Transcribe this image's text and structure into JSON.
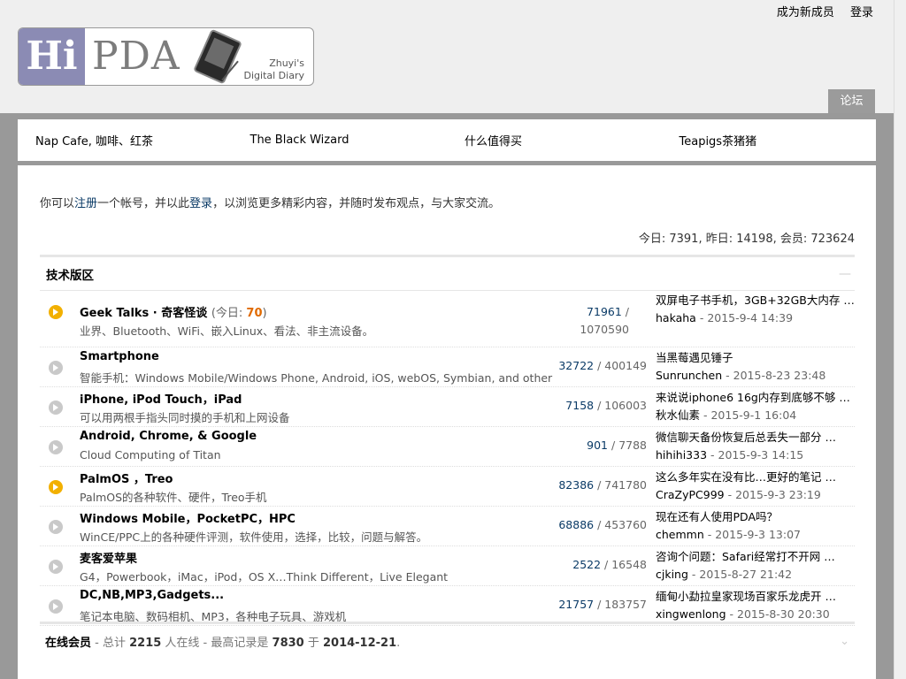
{
  "top_links": [
    "成为新成员",
    "登录"
  ],
  "logo": {
    "hi": "Hi",
    "pda": "PDA",
    "tagline1": "Zhuyi's",
    "tagline2": "Digital Diary"
  },
  "forum_tab": "论坛",
  "nav": [
    "Nap Cafe, 咖啡、红茶",
    "The Black Wizard",
    "什么值得买",
    "Teapigs茶猪猪"
  ],
  "welcome": {
    "pre": "你可以",
    "register": "注册",
    "mid": "一个帐号，并以此",
    "login": "登录",
    "post": "，以浏览更多精彩内容，并随时发布观点，与大家交流。"
  },
  "stats": "今日: 7391, 昨日: 14198, 会员: 723624",
  "section": {
    "title": "技术版区",
    "collapse": "—"
  },
  "forums": [
    {
      "name": "Geek Talks · 奇客怪谈",
      "today_label": "(今日: ",
      "today_count": "70",
      "today_close": ")",
      "desc": "业界、Bluetooth、WiFi、嵌入Linux、看法、非主流设备。",
      "threads": "71961",
      "posts": "1070590",
      "last_title": "双屏电子书手机，3GB+32GB大内存 …",
      "last_user": "hakaha",
      "last_time": "2015-9-4 14:39",
      "icon": "new"
    },
    {
      "name": "Smartphone",
      "desc": "智能手机：Windows Mobile/Windows Phone, Android, iOS, webOS, Symbian, and other",
      "threads": "32722",
      "posts": "400149",
      "last_title": "当黑莓遇见锤子",
      "last_user": "Sunrunchen",
      "last_time": "2015-8-23 23:48",
      "icon": "old"
    },
    {
      "name": "iPhone, iPod Touch，iPad",
      "desc": "可以用两根手指头同时摸的手机和上网设备",
      "threads": "7158",
      "posts": "106003",
      "last_title": "来说说iphone6 16g内存到底够不够 …",
      "last_user": "秋水仙素",
      "last_time": "2015-9-1 16:04",
      "icon": "old"
    },
    {
      "name": "Android, Chrome, & Google",
      "desc": "Cloud Computing of Titan",
      "threads": "901",
      "posts": "7788",
      "last_title": "微信聊天备份恢复后总丢失一部分 …",
      "last_user": "hihihi333",
      "last_time": "2015-9-3 14:15",
      "icon": "old"
    },
    {
      "name": "PalmOS ，Treo",
      "desc": "PalmOS的各种软件、硬件，Treo手机",
      "threads": "82386",
      "posts": "741780",
      "last_title": "这么多年实在没有比…更好的笔记 …",
      "last_user": "CraZyPC999",
      "last_time": "2015-9-3 23:19",
      "icon": "new"
    },
    {
      "name": "Windows Mobile，PocketPC，HPC",
      "desc": "WinCE/PPC上的各种硬件评测，软件使用，选择，比较，问题与解答。",
      "threads": "68886",
      "posts": "453760",
      "last_title": "现在还有人使用PDA吗？",
      "last_user": "chemmn",
      "last_time": "2015-9-3 13:07",
      "icon": "old"
    },
    {
      "name": "麦客爱苹果",
      "desc": "G4，Powerbook，iMac，iPod，OS X…Think Different，Live Elegant",
      "threads": "2522",
      "posts": "16548",
      "last_title": "咨询个问题：Safari经常打不开网 …",
      "last_user": "cjking",
      "last_time": "2015-8-27 21:42",
      "icon": "old"
    },
    {
      "name": "DC,NB,MP3,Gadgets...",
      "desc": "笔记本电脑、数码相机、MP3，各种电子玩具、游戏机",
      "threads": "21757",
      "posts": "183757",
      "last_title": "缅甸小勐拉皇家现场百家乐龙虎开 …",
      "last_user": "xingwenlong",
      "last_time": "2015-8-30 20:30",
      "icon": "old"
    }
  ],
  "online": {
    "title": "在线会员",
    "t1": " - 总计 ",
    "total": "2215",
    "t2": " 人在线 - 最高记录是 ",
    "max": "7830",
    "t3": " 于 ",
    "date": "2014-12-21",
    "t4": "."
  },
  "colors": {
    "header_bg": "#efefef",
    "page_bg": "#999999",
    "logo_hi_bg": "#8b8bb4",
    "new_icon": "#f2b000",
    "link": "#0a3a66",
    "today_count": "#e06a00"
  }
}
